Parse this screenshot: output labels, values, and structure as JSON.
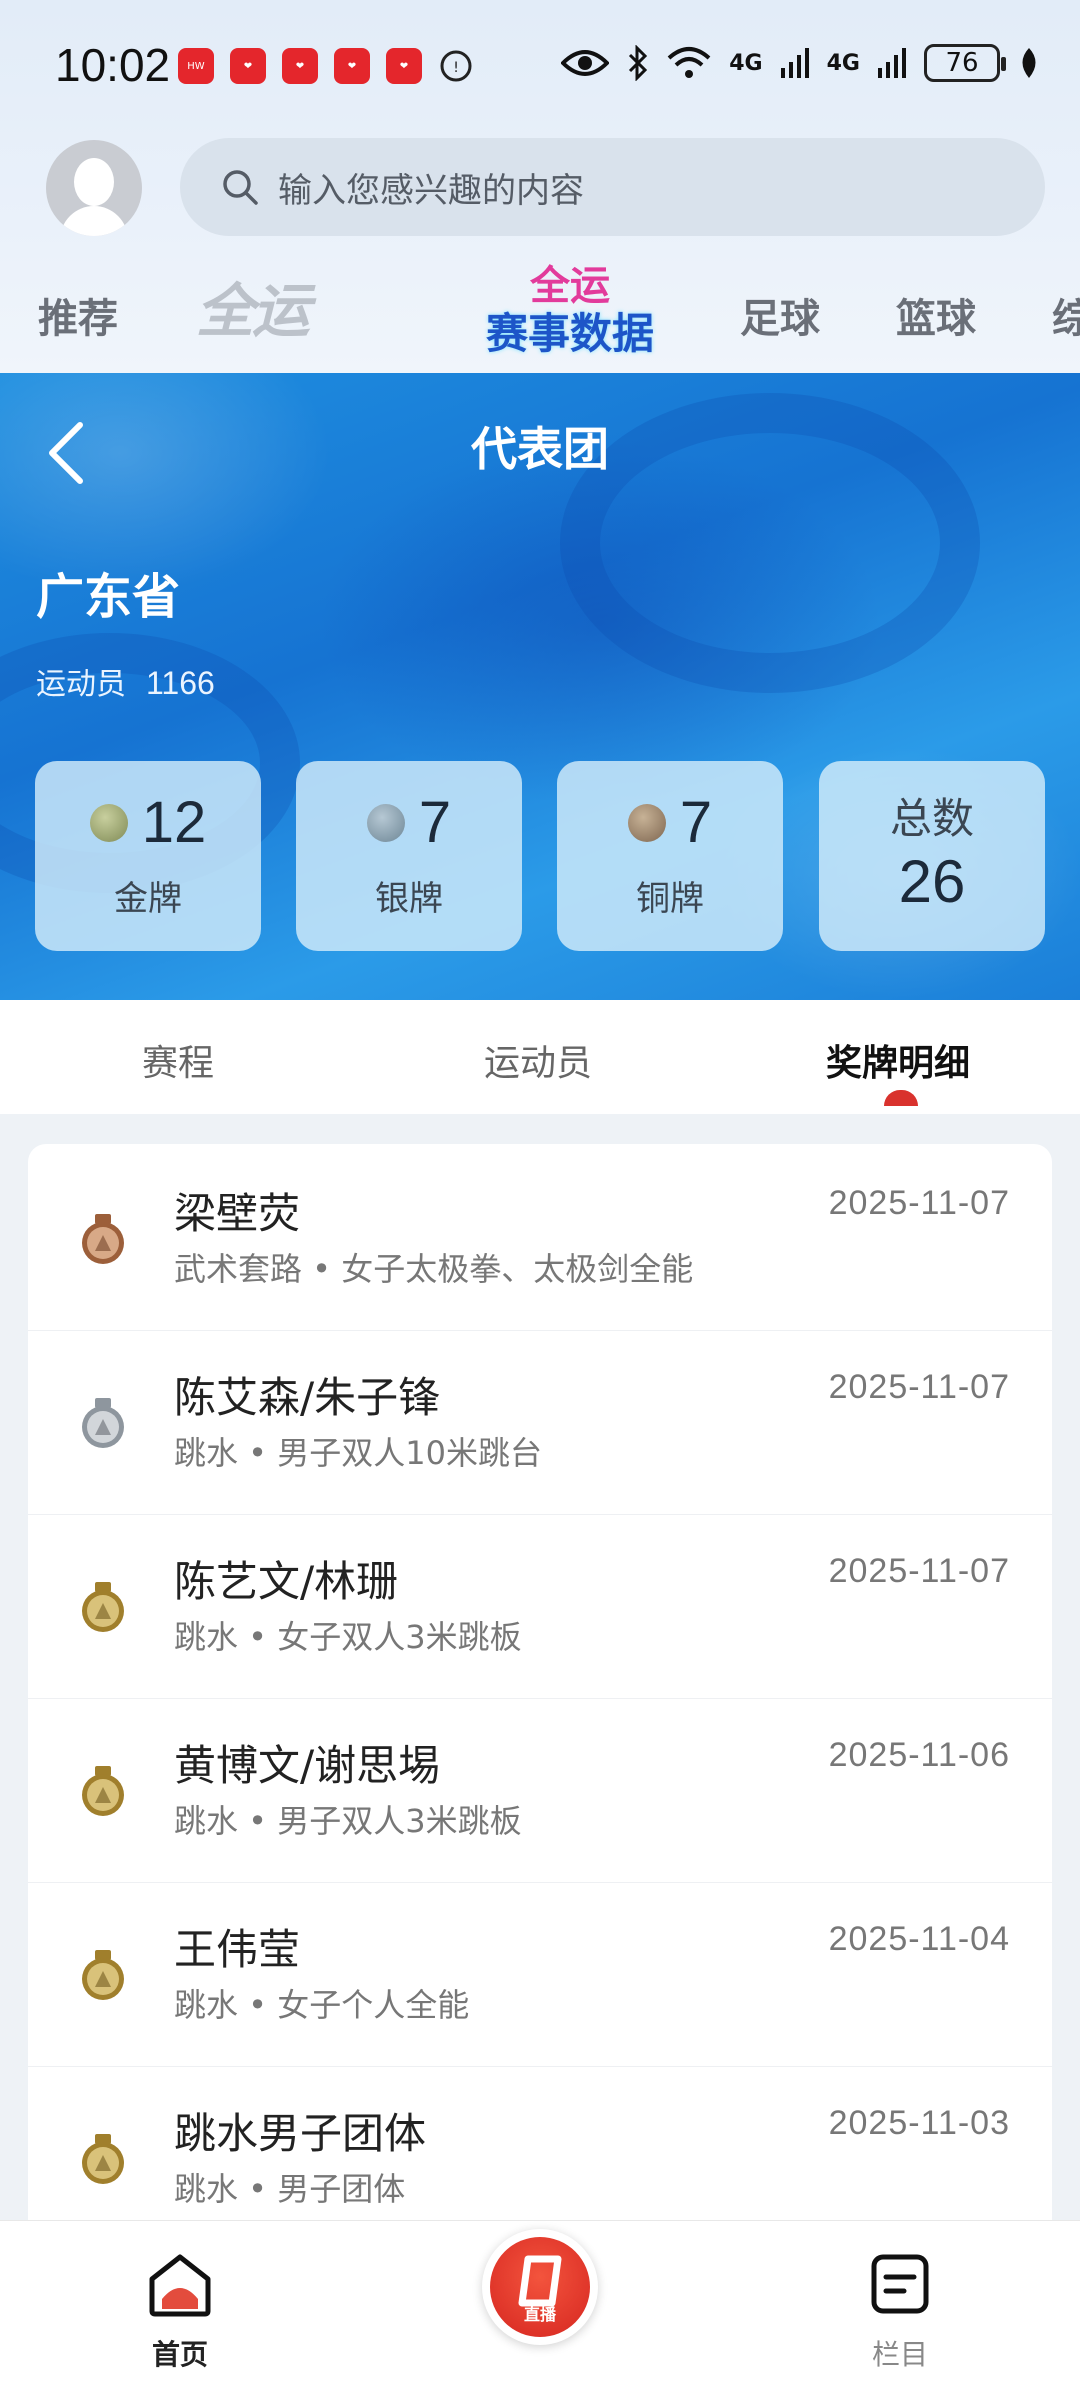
{
  "status_bar": {
    "time": "10:02",
    "network_1": "4G",
    "network_2": "4G",
    "battery": "76"
  },
  "header": {
    "search_placeholder": "输入您感兴趣的内容",
    "channels": {
      "recommend": "推荐",
      "games_logo": "全运2025",
      "data_logo_line1": "全运",
      "data_logo_line2": "赛事数据",
      "football": "足球",
      "basketball": "篮球",
      "more": "综"
    }
  },
  "hero": {
    "title": "代表团",
    "team_name": "广东省",
    "athletes_label": "运动员",
    "athletes_count": "1166",
    "medals": {
      "gold_count": "12",
      "gold_label": "金牌",
      "silver_count": "7",
      "silver_label": "银牌",
      "bronze_count": "7",
      "bronze_label": "铜牌",
      "total_label": "总数",
      "total_count": "26"
    }
  },
  "tabs": {
    "schedule": "赛程",
    "athletes": "运动员",
    "medal_detail": "奖牌明细"
  },
  "medal_list": [
    {
      "name": "梁壁荧",
      "event": "武术套路 • 女子太极拳、太极剑全能",
      "date": "2025-11-07",
      "medal": "bronze"
    },
    {
      "name": "陈艾森/朱子锋",
      "event": "跳水 • 男子双人10米跳台",
      "date": "2025-11-07",
      "medal": "silver"
    },
    {
      "name": "陈艺文/林珊",
      "event": "跳水 • 女子双人3米跳板",
      "date": "2025-11-07",
      "medal": "gold"
    },
    {
      "name": "黄博文/谢思埸",
      "event": "跳水 • 男子双人3米跳板",
      "date": "2025-11-06",
      "medal": "gold"
    },
    {
      "name": "王伟莹",
      "event": "跳水 • 女子个人全能",
      "date": "2025-11-04",
      "medal": "gold"
    },
    {
      "name": "跳水男子团体",
      "event": "跳水 • 男子团体",
      "date": "2025-11-03",
      "medal": "gold"
    }
  ],
  "bottom_nav": {
    "home": "首页",
    "live": "直播",
    "columns": "栏目"
  },
  "colors": {
    "accent_red": "#d9322d",
    "hero_blue": "#1673d2",
    "gold": "#c2a03c",
    "silver": "#9aa2aa",
    "bronze": "#b07350"
  }
}
